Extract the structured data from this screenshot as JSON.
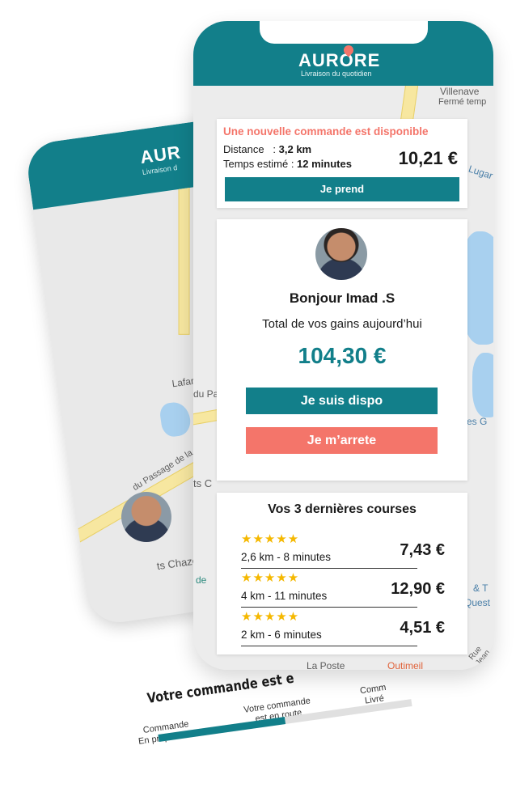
{
  "brand": {
    "name": "AURORE",
    "tagline": "Livraison du quotidien",
    "colors": {
      "primary": "#127f8a",
      "accent": "#f4756a",
      "stars": "#f5b800"
    }
  },
  "back_phone": {
    "brand_partial": "AUR",
    "tagline_partial": "Livraison d",
    "map_labels": [
      "Lafarge",
      "du Passage de la Côte",
      "ts Chazot"
    ],
    "order_title": "Votre commande est e",
    "steps": [
      {
        "lines": [
          "Commande",
          "En preparation"
        ]
      },
      {
        "lines": [
          "Votre commande",
          "est en route"
        ]
      },
      {
        "lines": [
          "Comm",
          "Livré"
        ]
      }
    ],
    "progress_fraction": 0.5
  },
  "map_labels": {
    "top_right_1": "Villenave",
    "top_right_2": "Fermé temp",
    "lugar": "Lugar",
    "du_pa": "du Pa",
    "es_g": "es G",
    "ts_c": "ts C",
    "de": "de",
    "right_1": "& T",
    "right_2": "Quest",
    "bottom_left": "La Poste",
    "bottom_mid": "Outimeil",
    "bottom_right": "Rue Jean"
  },
  "order": {
    "heading": "Une nouvelle commande est disponible",
    "distance_label": "Distance",
    "distance_value": "3,2 km",
    "time_label": "Temps estimé",
    "time_value": "12 minutes",
    "price": "10,21 €",
    "button": "Je prend"
  },
  "earnings": {
    "greeting": "Bonjour Imad .S",
    "total_label": "Total de vos gains aujourd’hui",
    "total_value": "104,30 €",
    "btn_available": "Je suis dispo",
    "btn_stop": "Je m’arrete"
  },
  "courses": {
    "title": "Vos 3 dernières courses",
    "items": [
      {
        "stars": "★★★★★",
        "desc": "2,6 km - 8 minutes",
        "price": "7,43 €"
      },
      {
        "stars": "★★★★★",
        "desc": "4 km - 11 minutes",
        "price": "12,90 €"
      },
      {
        "stars": "★★★★★",
        "desc": "2 km - 6 minutes",
        "price": "4,51 €"
      }
    ]
  }
}
